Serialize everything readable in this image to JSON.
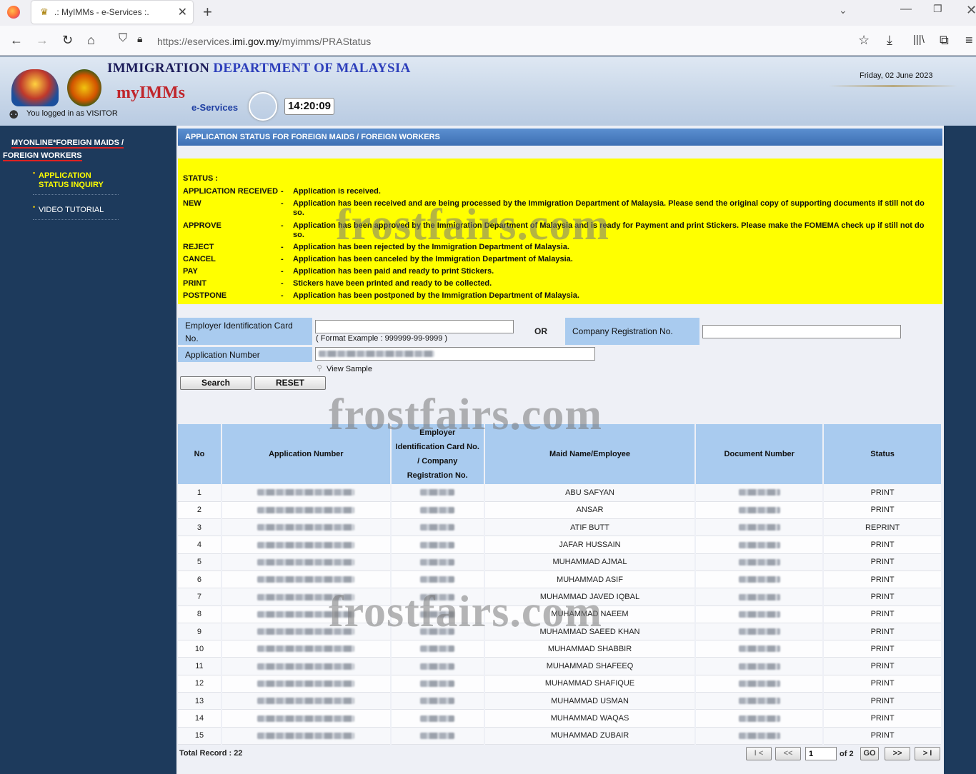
{
  "browser": {
    "tab_title": ".: MyIMMs - e-Services :.",
    "url_prefix": "https://eservices.",
    "url_domain": "imi.gov.my",
    "url_path": "/myimms/PRAStatus"
  },
  "header": {
    "dept_title_part1": "IMMIGRATION",
    "dept_title_part2": "DEPARTMENT OF MALAYSIA",
    "brand": "myIMMs",
    "subbrand": "e-Services",
    "clock": "14:20:09",
    "logged_in": "You logged in as VISITOR",
    "date": "Friday, 02 June 2023"
  },
  "sidebar": {
    "title_line1": "MYONLINE*FOREIGN MAIDS /",
    "title_line2": "FOREIGN WORKERS",
    "items": [
      {
        "label_line1": "APPLICATION",
        "label_line2": "STATUS INQUIRY"
      },
      {
        "label_line1": "VIDEO TUTORIAL",
        "label_line2": ""
      }
    ]
  },
  "panel_title": "APPLICATION STATUS FOR FOREIGN MAIDS / FOREIGN WORKERS",
  "status_legend": {
    "heading": "STATUS :",
    "rows": [
      {
        "key": "APPLICATION RECEIVED",
        "desc": "Application is received."
      },
      {
        "key": "NEW",
        "desc": "Application has been received and are being processed by the Immigration Department of Malaysia. Please send the original copy of supporting documents if still not do so."
      },
      {
        "key": "APPROVE",
        "desc": "Application has been approved by the Immigration Department of Malaysia and is ready for Payment and print Stickers. Please make the FOMEMA check up if still not do so."
      },
      {
        "key": "REJECT",
        "desc": "Application has been rejected by the Immigration Department of Malaysia."
      },
      {
        "key": "CANCEL",
        "desc": "Application has been canceled by the Immigration Department of Malaysia."
      },
      {
        "key": "PAY",
        "desc": "Application has been paid and ready to print Stickers."
      },
      {
        "key": "PRINT",
        "desc": "Stickers have been printed and ready to be collected."
      },
      {
        "key": "POSTPONE",
        "desc": "Application has been postponed by the Immigration Department of Malaysia."
      }
    ]
  },
  "form": {
    "employer_ic_label": "Employer Identification Card No.",
    "employer_ic_value": "",
    "format_example": "( Format Example : 999999-99-9999 )",
    "or_label": "OR",
    "company_reg_label": "Company Registration No.",
    "company_reg_value": "",
    "application_number_label": "Application Number",
    "view_sample": "View Sample",
    "search_button": "Search",
    "reset_button": "RESET"
  },
  "table": {
    "headers": [
      "No",
      "Application Number",
      "Employer Identification Card No. / Company Registration No.",
      "Maid Name/Employee",
      "Document Number",
      "Status"
    ],
    "rows": [
      {
        "no": "1",
        "name": "ABU SAFYAN",
        "status": "PRINT"
      },
      {
        "no": "2",
        "name": "ANSAR",
        "status": "PRINT"
      },
      {
        "no": "3",
        "name": "ATIF BUTT",
        "status": "REPRINT"
      },
      {
        "no": "4",
        "name": "JAFAR HUSSAIN",
        "status": "PRINT"
      },
      {
        "no": "5",
        "name": "MUHAMMAD AJMAL",
        "status": "PRINT"
      },
      {
        "no": "6",
        "name": "MUHAMMAD ASIF",
        "status": "PRINT"
      },
      {
        "no": "7",
        "name": "MUHAMMAD JAVED IQBAL",
        "status": "PRINT"
      },
      {
        "no": "8",
        "name": "MUHAMMAD NAEEM",
        "status": "PRINT"
      },
      {
        "no": "9",
        "name": "MUHAMMAD SAEED KHAN",
        "status": "PRINT"
      },
      {
        "no": "10",
        "name": "MUHAMMAD SHABBIR",
        "status": "PRINT"
      },
      {
        "no": "11",
        "name": "MUHAMMAD SHAFEEQ",
        "status": "PRINT"
      },
      {
        "no": "12",
        "name": "MUHAMMAD SHAFIQUE",
        "status": "PRINT"
      },
      {
        "no": "13",
        "name": "MUHAMMAD USMAN",
        "status": "PRINT"
      },
      {
        "no": "14",
        "name": "MUHAMMAD WAQAS",
        "status": "PRINT"
      },
      {
        "no": "15",
        "name": "MUHAMMAD ZUBAIR",
        "status": "PRINT"
      }
    ],
    "total_record": "Total Record : 22"
  },
  "pagination": {
    "first": "I <",
    "prev": "<<",
    "page_value": "1",
    "of_text": "of  2",
    "go": "GO",
    "next": ">>",
    "last": "> I"
  },
  "watermark": "frostfairs.com"
}
